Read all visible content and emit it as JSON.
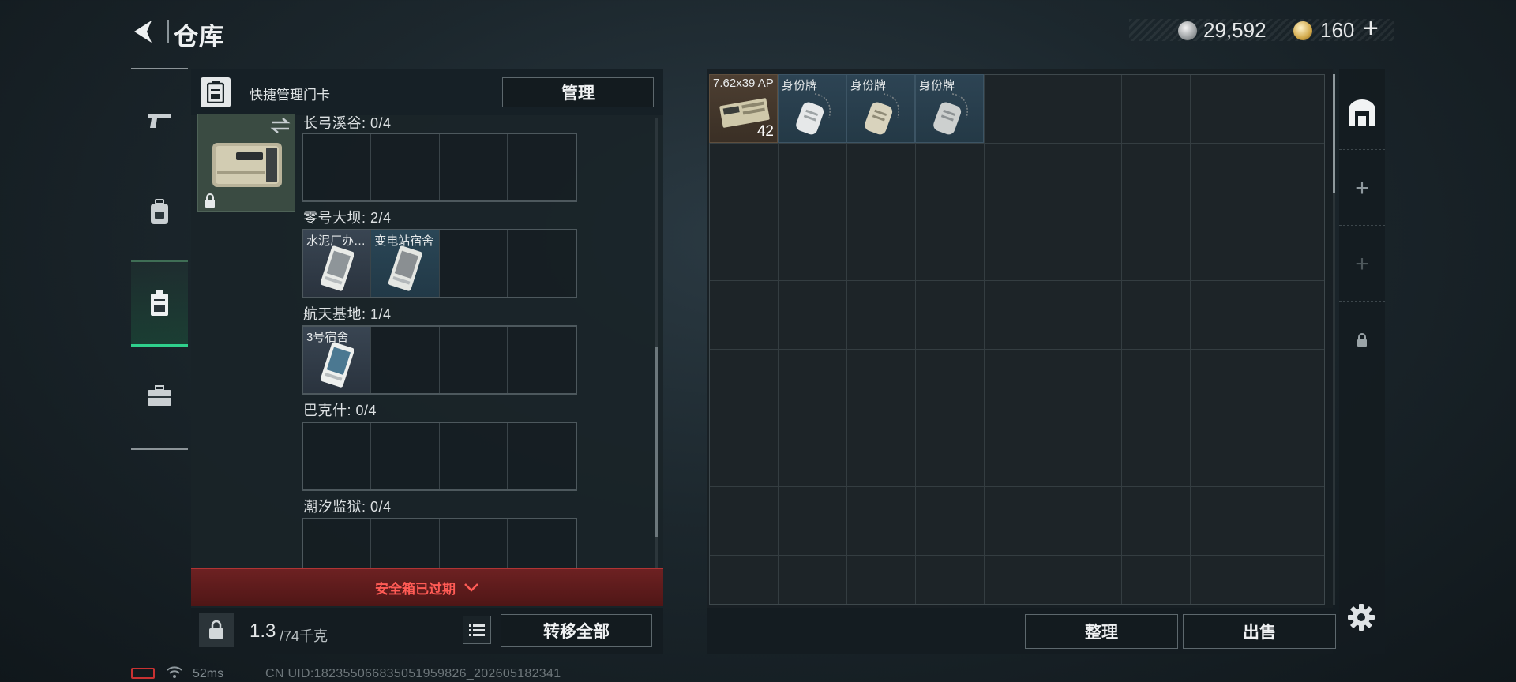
{
  "header": {
    "title": "仓库",
    "currency": {
      "silver": "29,592",
      "gold": "160",
      "plus": "+"
    }
  },
  "sidebar": {
    "tabs": [
      {
        "name": "weapon",
        "icon": "gun-icon",
        "active": false
      },
      {
        "name": "backpack",
        "icon": "backpack-icon",
        "active": false
      },
      {
        "name": "safe-case",
        "icon": "case-icon",
        "active": true
      },
      {
        "name": "tools",
        "icon": "toolbox-icon",
        "active": false
      }
    ]
  },
  "left_panel": {
    "header_title": "快捷管理门卡",
    "manage_label": "管理",
    "maps": [
      {
        "label": "长弓溪谷: 0/4",
        "cards": []
      },
      {
        "label": "零号大坝: 2/4",
        "cards": [
          {
            "name": "水泥厂办…",
            "tint": "purple"
          },
          {
            "name": "变电站宿舍",
            "tint": "blue"
          }
        ]
      },
      {
        "label": "航天基地: 1/4",
        "cards": [
          {
            "name": "3号宿舍",
            "tint": "purple"
          }
        ]
      },
      {
        "label": "巴克什: 0/4",
        "cards": []
      },
      {
        "label": "潮汐监狱: 0/4",
        "cards": []
      }
    ],
    "expired_text": "安全箱已过期",
    "weight_value": "1.3",
    "weight_max": "/74千克",
    "transfer_all_label": "转移全部"
  },
  "storage": {
    "items": [
      {
        "name": "7.62x39 AP",
        "count": "42",
        "type": "ammo"
      },
      {
        "name": "身份牌",
        "type": "dogtag"
      },
      {
        "name": "身份牌",
        "type": "dogtag"
      },
      {
        "name": "身份牌",
        "type": "dogtag"
      }
    ],
    "sort_label": "整理",
    "sell_label": "出售"
  },
  "status": {
    "ping": "52ms",
    "uid": "CN UID:182355066835051959826_202605182341"
  }
}
